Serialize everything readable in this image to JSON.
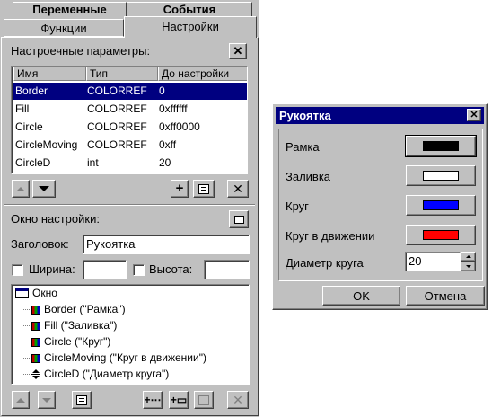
{
  "tabs": {
    "variables": "Переменные",
    "events": "События",
    "functions": "Функции",
    "settings": "Настройки"
  },
  "params": {
    "title": "Настроечные параметры:",
    "columns": [
      "Имя",
      "Тип",
      "До настройки"
    ],
    "rows": [
      {
        "name": "Border",
        "type": "COLORREF",
        "value": "0"
      },
      {
        "name": "Fill",
        "type": "COLORREF",
        "value": "0xffffff"
      },
      {
        "name": "Circle",
        "type": "COLORREF",
        "value": "0xff0000"
      },
      {
        "name": "CircleMoving",
        "type": "COLORREF",
        "value": "0xff"
      },
      {
        "name": "CircleD",
        "type": "int",
        "value": "20"
      }
    ],
    "selected_row": 0
  },
  "window": {
    "title": "Окно настройки:",
    "caption_label": "Заголовок:",
    "caption_value": "Рукоятка",
    "width_label": "Ширина:",
    "height_label": "Высота:",
    "width_value": "",
    "height_value": ""
  },
  "tree": {
    "root": "Окно",
    "items": [
      {
        "label": "Border (\"Рамка\")",
        "icon": "palette-icon"
      },
      {
        "label": "Fill (\"Заливка\")",
        "icon": "palette-icon"
      },
      {
        "label": "Circle (\"Круг\")",
        "icon": "palette-icon"
      },
      {
        "label": "CircleMoving (\"Круг в движении\")",
        "icon": "palette-icon"
      },
      {
        "label": "CircleD (\"Диаметр круга\")",
        "icon": "spin-icon"
      }
    ]
  },
  "dialog": {
    "title": "Рукоятка",
    "rows": [
      {
        "label": "Рамка",
        "color": "#000000"
      },
      {
        "label": "Заливка",
        "color": "#ffffff"
      },
      {
        "label": "Круг",
        "color": "#0000ff"
      },
      {
        "label": "Круг в движении",
        "color": "#ff0000"
      }
    ],
    "diameter_label": "Диаметр круга",
    "diameter_value": "20",
    "ok": "OK",
    "cancel": "Отмена"
  },
  "colors": {
    "selection": "#000080",
    "face": "#c0c0c0",
    "titlebar": "#000080"
  }
}
